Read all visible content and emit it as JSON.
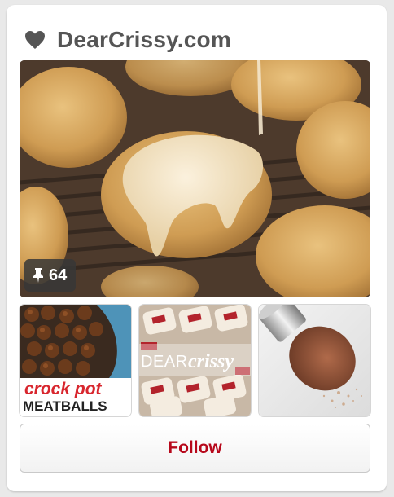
{
  "board": {
    "title": "DearCrissy.com",
    "icon": "heart-icon"
  },
  "main_image": {
    "alt": "glazed pumpkin cookies",
    "pin_icon": "pin-icon",
    "pin_count": "64"
  },
  "thumbnails": [
    {
      "alt": "crock pot meatballs",
      "caption_line1": "crock pot",
      "caption_line2": "MEATBALLS"
    },
    {
      "alt": "dearcrissy pastries",
      "watermark_a": "DEAR",
      "watermark_b": "crissy"
    },
    {
      "alt": "makeup brush with powder"
    }
  ],
  "follow_button": {
    "label": "Follow"
  },
  "colors": {
    "title": "#555555",
    "follow_text": "#b7081b",
    "card_bg": "#ffffff",
    "page_bg": "#e9e9e9"
  }
}
